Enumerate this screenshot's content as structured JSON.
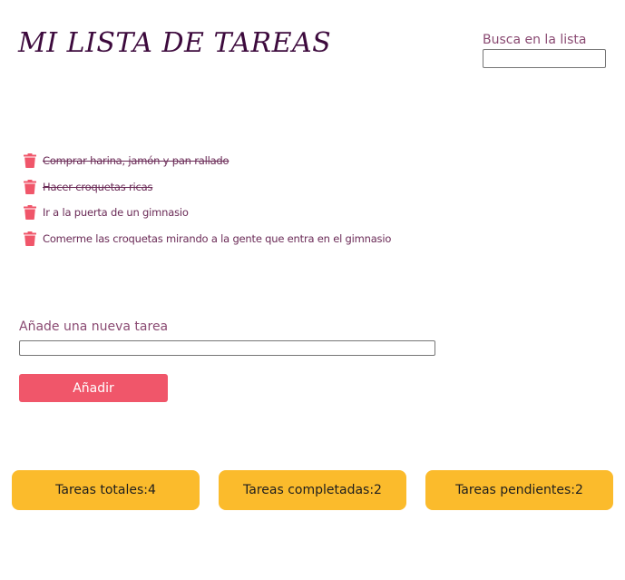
{
  "header": {
    "title": "MI LISTA DE TAREAS"
  },
  "search": {
    "label": "Busca en la lista",
    "value": ""
  },
  "tasks": [
    {
      "text": "Comprar harina, jamón y pan rallado",
      "completed": true
    },
    {
      "text": "Hacer croquetas ricas",
      "completed": true
    },
    {
      "text": "Ir a la puerta de un gimnasio",
      "completed": false
    },
    {
      "text": "Comerme las croquetas mirando a la gente que entra en el gimnasio",
      "completed": false
    }
  ],
  "new_task": {
    "label": "Añade una nueva tarea",
    "value": "",
    "button_label": "Añadir"
  },
  "counters": {
    "total": "Tareas totales:4",
    "completed": "Tareas completadas:2",
    "pending": "Tareas pendientes:2"
  },
  "icons": {
    "delete": "trash-icon"
  },
  "colors": {
    "title": "#3d0a3d",
    "label": "#8a4a72",
    "task_text": "#6a2a56",
    "trash_icon": "#f0566a",
    "add_button": "#f0566a",
    "counter_bg": "#fbbb2c"
  }
}
